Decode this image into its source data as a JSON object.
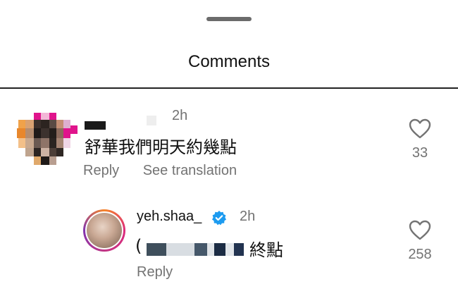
{
  "header": {
    "title": "Comments"
  },
  "comments": [
    {
      "time": "2h",
      "text": "舒華我們明天約幾點",
      "actions": [
        "Reply",
        "See translation"
      ],
      "likes": "33"
    }
  ],
  "reply": {
    "username": "yeh.shaa_",
    "verified": true,
    "time": "2h",
    "text_visible": "終點",
    "text_prefix": "(",
    "action": "Reply",
    "likes": "258"
  },
  "icons": [
    "heart-icon",
    "verified-badge-icon"
  ],
  "colors": {
    "muted": "#737373",
    "verified": "#1d9bf0",
    "text": "#111111"
  }
}
